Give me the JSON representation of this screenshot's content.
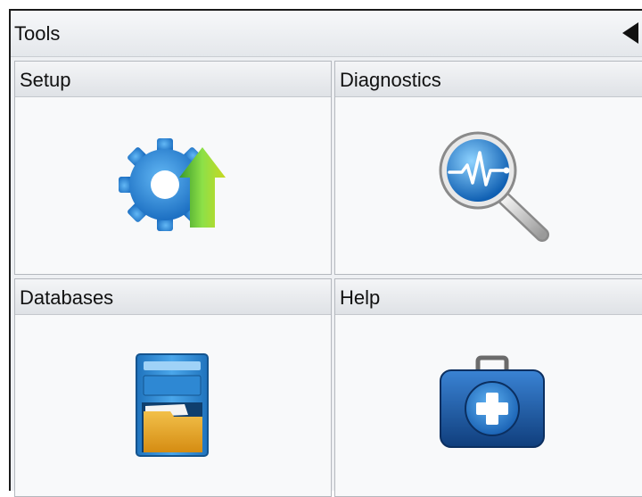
{
  "window": {
    "title": "Tools"
  },
  "tiles": [
    {
      "label": "Setup",
      "icon": "gear-update-icon"
    },
    {
      "label": "Diagnostics",
      "icon": "magnifier-waveform-icon"
    },
    {
      "label": "Databases",
      "icon": "file-cabinet-icon"
    },
    {
      "label": "Help",
      "icon": "first-aid-kit-icon"
    }
  ],
  "colors": {
    "gear_blue": "#2a86d8",
    "arrow_green": "#6cc830",
    "cabinet_blue": "#2f8fd6",
    "folder_orange": "#e3a020",
    "kit_blue": "#1d5fae"
  }
}
